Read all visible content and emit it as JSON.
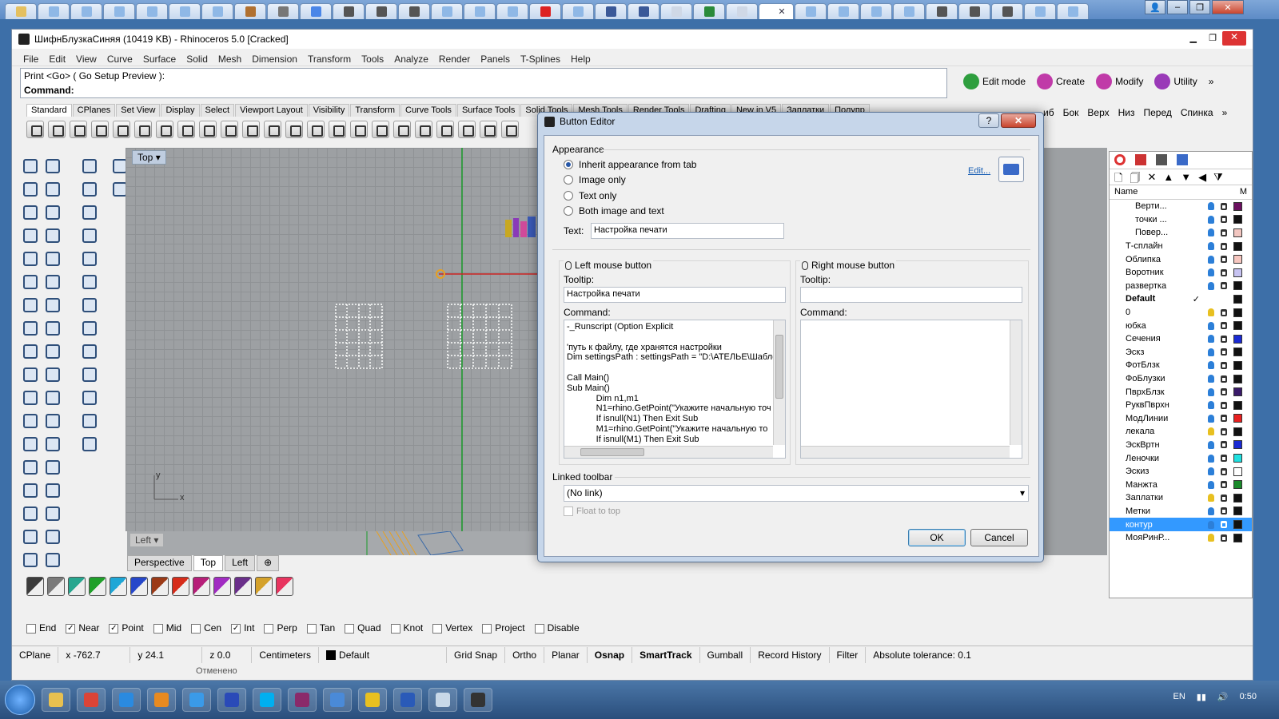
{
  "browser": {
    "tabs": [
      {
        "icon": "folder-icon",
        "color": "#e4c060"
      },
      {
        "icon": "cloud-icon",
        "color": "#8fb8e6"
      },
      {
        "icon": "cloud-icon",
        "color": "#8fb8e6"
      },
      {
        "icon": "cloud-icon",
        "color": "#8fb8e6"
      },
      {
        "icon": "cloud-icon",
        "color": "#8fb8e6"
      },
      {
        "icon": "cloud-icon",
        "color": "#8fb8e6"
      },
      {
        "icon": "cloud-icon",
        "color": "#8fb8e6"
      },
      {
        "icon": "vk-icon",
        "color": "#b07030"
      },
      {
        "icon": "page-icon",
        "color": "#777777"
      },
      {
        "icon": "google-icon",
        "color": "#4a86e8"
      },
      {
        "icon": "3dfshn-icon",
        "color": "#555555"
      },
      {
        "icon": "3dfshn-icon",
        "color": "#555555"
      },
      {
        "icon": "3dfshn-icon",
        "color": "#555555"
      },
      {
        "icon": "dress-icon",
        "color": "#8fb8e6"
      },
      {
        "icon": "dress-icon",
        "color": "#8fb8e6"
      },
      {
        "icon": "dress-icon",
        "color": "#8fb8e6"
      },
      {
        "icon": "youtube-icon",
        "color": "#d22"
      },
      {
        "icon": "dress-icon",
        "color": "#8fb8e6"
      },
      {
        "icon": "facebook-icon",
        "color": "#3b5998"
      },
      {
        "icon": "facebook-icon",
        "color": "#3b5998"
      },
      {
        "icon": "page-icon",
        "color": "#cfd8e6"
      },
      {
        "icon": "plant-icon",
        "color": "#2a8a3a"
      },
      {
        "icon": "page-icon",
        "color": "#cfd8e6"
      },
      {
        "icon": "active-tab",
        "color": "#ffffff"
      },
      {
        "icon": "cloud-icon",
        "color": "#8fb8e6"
      },
      {
        "icon": "cloud-icon",
        "color": "#8fb8e6"
      },
      {
        "icon": "cloud-icon",
        "color": "#8fb8e6"
      },
      {
        "icon": "cloud-icon",
        "color": "#8fb8e6"
      },
      {
        "icon": "3dfshn-icon",
        "color": "#555555"
      },
      {
        "icon": "3dfshn-icon",
        "color": "#555555"
      },
      {
        "icon": "3dfshn-icon",
        "color": "#555555"
      },
      {
        "icon": "dress-icon",
        "color": "#8fb8e6"
      },
      {
        "icon": "dress-icon",
        "color": "#8fb8e6"
      }
    ],
    "active_close": "✕"
  },
  "window": {
    "title": "ШифнБлузкаСиняя (10419 KB) - Rhinoceros 5.0 [Cracked]",
    "menu": [
      "File",
      "Edit",
      "View",
      "Curve",
      "Surface",
      "Solid",
      "Mesh",
      "Dimension",
      "Transform",
      "Tools",
      "Analyze",
      "Render",
      "Panels",
      "T-Splines",
      "Help"
    ]
  },
  "command": {
    "line1": "Print <Go> ( Go  Setup  Preview ):",
    "line2": "Command:"
  },
  "modes": [
    {
      "label": "Edit mode",
      "icon": "power-icon",
      "color": "#2e9e3e"
    },
    {
      "label": "Create",
      "icon": "cube-icon",
      "color": "#c03aa8"
    },
    {
      "label": "Modify",
      "icon": "modify-icon",
      "color": "#c03aa8"
    },
    {
      "label": "Utility",
      "icon": "gear-icon",
      "color": "#9a3ab8"
    }
  ],
  "toolbar_tabs": [
    "Standard",
    "CPlanes",
    "Set View",
    "Display",
    "Select",
    "Viewport Layout",
    "Visibility",
    "Transform",
    "Curve Tools",
    "Surface Tools",
    "Solid Tools",
    "Mesh Tools",
    "Render Tools",
    "Drafting",
    "New in V5",
    "Заплатки",
    "Полупр"
  ],
  "view_names": [
    "...иб",
    "Бок",
    "Верх",
    "Низ",
    "Перед",
    "Спинка"
  ],
  "viewport": {
    "top_label": "Top",
    "left_label": "Left",
    "axis_y": "y",
    "axis_x": "x",
    "tabs": [
      "Perspective",
      "Top",
      "Left"
    ],
    "active_tab": "Top"
  },
  "swatches": [
    "#3b3b3b",
    "#7a7a7a",
    "#27a68f",
    "#1fa02a",
    "#1ea6d6",
    "#2647c9",
    "#9b3a17",
    "#d62c1a",
    "#b61e78",
    "#a12bc2",
    "#6a2f8a",
    "#d4a12a",
    "#e8345f"
  ],
  "osnap": [
    {
      "label": "End",
      "checked": false
    },
    {
      "label": "Near",
      "checked": true
    },
    {
      "label": "Point",
      "checked": true
    },
    {
      "label": "Mid",
      "checked": false
    },
    {
      "label": "Cen",
      "checked": false
    },
    {
      "label": "Int",
      "checked": true
    },
    {
      "label": "Perp",
      "checked": false
    },
    {
      "label": "Tan",
      "checked": false
    },
    {
      "label": "Quad",
      "checked": false
    },
    {
      "label": "Knot",
      "checked": false
    },
    {
      "label": "Vertex",
      "checked": false
    },
    {
      "label": "Project",
      "checked": false
    },
    {
      "label": "Disable",
      "checked": false
    }
  ],
  "status": {
    "cplane": "CPlane",
    "x": "x -762.7",
    "y": "y 24.1",
    "z": "z 0.0",
    "units": "Centimeters",
    "layer": "Default",
    "grid_snap": "Grid Snap",
    "ortho": "Ortho",
    "planar": "Planar",
    "osnap": "Osnap",
    "smarttrack": "SmartTrack",
    "gumball": "Gumball",
    "record_history": "Record History",
    "filter": "Filter",
    "tolerance": "Absolute tolerance: 0.1",
    "previous": "Отменено"
  },
  "layers": {
    "header": "Name",
    "header_m": "M",
    "rows": [
      {
        "name": "Верти...",
        "indent": true,
        "color": "#6b1060",
        "bulb": "#2c7fd8"
      },
      {
        "name": "точки ...",
        "indent": true,
        "color": "#111111",
        "bulb": "#2c7fd8"
      },
      {
        "name": "Повер...",
        "indent": true,
        "color": "#f2c6c0",
        "bulb": "#2c7fd8"
      },
      {
        "name": "Т-сплайн",
        "indent": false,
        "color": "#111111",
        "bulb": "#2c7fd8"
      },
      {
        "name": "Облипка",
        "indent": false,
        "color": "#f7c7c0",
        "bulb": "#2c7fd8"
      },
      {
        "name": "Воротник",
        "indent": false,
        "color": "#c7c3f2",
        "bulb": "#2c7fd8"
      },
      {
        "name": "развертка",
        "indent": false,
        "color": "#111111",
        "bulb": "#2c7fd8"
      },
      {
        "name": "Default",
        "indent": false,
        "color": "#111111",
        "bulb": "none",
        "current": "✓"
      },
      {
        "name": "0",
        "indent": false,
        "color": "#111111",
        "bulb": "#e8c020"
      },
      {
        "name": "юбка",
        "indent": false,
        "color": "#111111",
        "bulb": "#2c7fd8"
      },
      {
        "name": "Сечения",
        "indent": false,
        "color": "#1a2ad4",
        "bulb": "#2c7fd8"
      },
      {
        "name": "Эскз",
        "indent": false,
        "color": "#111111",
        "bulb": "#2c7fd8"
      },
      {
        "name": "ФотБлзк",
        "indent": false,
        "color": "#111111",
        "bulb": "#2c7fd8"
      },
      {
        "name": "ФоБлузки",
        "indent": false,
        "color": "#111111",
        "bulb": "#2c7fd8"
      },
      {
        "name": "ПврхБлзк",
        "indent": false,
        "color": "#3a1a6a",
        "bulb": "#2c7fd8"
      },
      {
        "name": "РуквПврхн",
        "indent": false,
        "color": "#111111",
        "bulb": "#2c7fd8"
      },
      {
        "name": "МодЛинии",
        "indent": false,
        "color": "#e82020",
        "bulb": "#2c7fd8"
      },
      {
        "name": "лекала",
        "indent": false,
        "color": "#111111",
        "bulb": "#e8c020"
      },
      {
        "name": "ЭскВртн",
        "indent": false,
        "color": "#1a2ad4",
        "bulb": "#2c7fd8"
      },
      {
        "name": "Леночки",
        "indent": false,
        "color": "#20e0e0",
        "bulb": "#2c7fd8"
      },
      {
        "name": "Эскиз",
        "indent": false,
        "color": "#ffffff",
        "bulb": "#2c7fd8"
      },
      {
        "name": "Манжта",
        "indent": false,
        "color": "#1a8a2a",
        "bulb": "#2c7fd8"
      },
      {
        "name": "Заплатки",
        "indent": false,
        "color": "#111111",
        "bulb": "#e8c020"
      },
      {
        "name": "Метки",
        "indent": false,
        "color": "#111111",
        "bulb": "#2c7fd8"
      },
      {
        "name": "контур",
        "indent": false,
        "color": "#111111",
        "bulb": "#2c7fd8",
        "selected": true
      },
      {
        "name": "МояРинР...",
        "indent": false,
        "color": "#111111",
        "bulb": "#e8c020"
      }
    ]
  },
  "dialog": {
    "title": "Button Editor",
    "help": "?",
    "close": "✕",
    "appearance": {
      "group": "Appearance",
      "options": [
        "Inherit appearance from tab",
        "Image only",
        "Text only",
        "Both image and text"
      ],
      "selected": 0,
      "edit_link": "Edit...",
      "text_label": "Text:",
      "text_value": "Настройка печати"
    },
    "left": {
      "group": "Left mouse button",
      "tooltip_label": "Tooltip:",
      "tooltip_value": "Настройка печати",
      "command_label": "Command:",
      "command_value": "-_Runscript (Option Explicit\n\n'путь к файлу, где хранятся настройки\nDim settingsPath : settingsPath = \"D:\\АТЕЛЬЕ\\Шабло\n\nCall Main()\nSub Main()\n            Dim n1,m1\n            N1=rhino.GetPoint(\"Укажите начальную точ\n            If isnull(N1) Then Exit Sub\n            M1=rhino.GetPoint(\"Укажите начальную то\n            If isnull(M1) Then Exit Sub"
    },
    "right": {
      "group": "Right mouse button",
      "tooltip_label": "Tooltip:",
      "tooltip_value": "",
      "command_label": "Command:",
      "command_value": ""
    },
    "linked": {
      "group": "Linked toolbar",
      "value": "(No link)",
      "float_label": "Float to top"
    },
    "ok": "OK",
    "cancel": "Cancel"
  },
  "taskbar": {
    "apps": [
      {
        "icon": "explorer-icon",
        "color": "#e8c050"
      },
      {
        "icon": "chrome-icon",
        "color": "#db4437"
      },
      {
        "icon": "ie-icon",
        "color": "#2a8ae0"
      },
      {
        "icon": "media-player-icon",
        "color": "#e88a20"
      },
      {
        "icon": "play-icon",
        "color": "#3a9ae8"
      },
      {
        "icon": "save-icon",
        "color": "#2a4ab8"
      },
      {
        "icon": "skype-icon",
        "color": "#00aff0"
      },
      {
        "icon": "winrar-icon",
        "color": "#8a2a6a"
      },
      {
        "icon": "monitor-icon",
        "color": "#4a8ad8"
      },
      {
        "icon": "help-icon",
        "color": "#e8c020"
      },
      {
        "icon": "word-icon",
        "color": "#2a5ab8"
      },
      {
        "icon": "window-icon",
        "color": "#c8d8e8"
      },
      {
        "icon": "rhino-icon",
        "color": "#333333"
      }
    ],
    "lang": "EN",
    "time": "0:50"
  }
}
